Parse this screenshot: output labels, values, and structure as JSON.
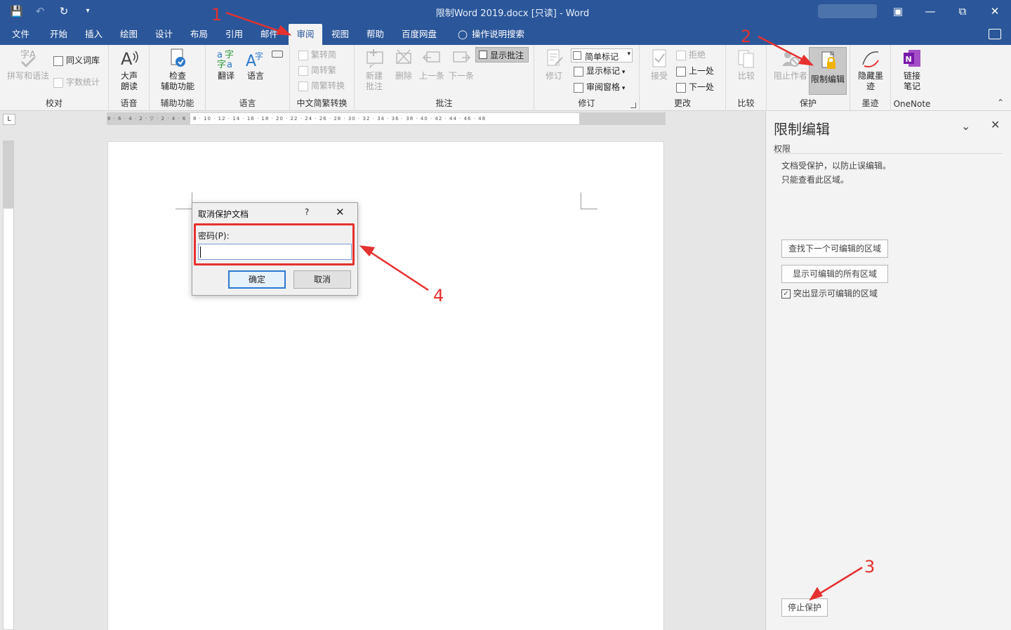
{
  "titlebar": {
    "title": "限制Word 2019.docx [只读]  -  Word",
    "controls": [
      "ribbon-display-icon",
      "minimize-icon",
      "restore-icon",
      "close-icon"
    ]
  },
  "tabs": [
    {
      "label": "文件"
    },
    {
      "label": "开始"
    },
    {
      "label": "插入"
    },
    {
      "label": "绘图"
    },
    {
      "label": "设计"
    },
    {
      "label": "布局"
    },
    {
      "label": "引用"
    },
    {
      "label": "邮件"
    },
    {
      "label": "审阅",
      "active": true
    },
    {
      "label": "视图"
    },
    {
      "label": "帮助"
    },
    {
      "label": "百度网盘"
    },
    {
      "label": "操作说明搜索"
    }
  ],
  "ribbon": {
    "proofing": {
      "label": "校对",
      "spelling": "拼写和语法",
      "thesaurus": "同义词库",
      "wordcount": "字数统计"
    },
    "speech": {
      "label": "语音",
      "read_aloud_1": "大声",
      "read_aloud_2": "朗读"
    },
    "accessibility": {
      "label": "辅助功能",
      "check_1": "检查",
      "check_2": "辅助功能"
    },
    "language": {
      "label": "语言",
      "translate": "翻译",
      "lang": "语言"
    },
    "chinese": {
      "label": "中文简繁转换",
      "to_simplified": "繁转简",
      "to_traditional": "简转繁",
      "convert": "简繁转换"
    },
    "comments": {
      "label": "批注",
      "new_1": "新建",
      "new_2": "批注",
      "delete": "删除",
      "prev": "上一条",
      "next": "下一条",
      "show": "显示批注"
    },
    "tracking": {
      "label": "修订",
      "track": "修订",
      "markup": "简单标记",
      "show_markup": "显示标记",
      "pane": "审阅窗格"
    },
    "changes": {
      "label": "更改",
      "accept": "接受",
      "reject": "拒绝",
      "prev": "上一处",
      "next": "下一处"
    },
    "compare": {
      "label": "比较",
      "compare": "比较"
    },
    "protect": {
      "label": "保护",
      "block": "阻止作者",
      "restrict": "限制编辑"
    },
    "ink": {
      "label": "墨迹",
      "hide_1": "隐藏墨",
      "hide_2": "迹"
    },
    "onenote": {
      "label": "OneNote",
      "link_1": "链接",
      "link_2": "笔记"
    }
  },
  "ruler": {
    "h_ticks": "8 · 6 · 4 · 2 · ▽ · 2 · 4 · 6 · 8 · 10 · 12 · 14 · 16 · 18 · 20 · 22 · 24 · 26 · 28 · 30 · 32 · 34 · 36 · 38 · 40 · 42 · 44 · 46 · 48",
    "corner": "L"
  },
  "dialog": {
    "title": "取消保护文档",
    "help": "?",
    "password_label": "密码(P):",
    "password_value": "",
    "ok": "确定",
    "cancel": "取消"
  },
  "pane": {
    "title": "限制编辑",
    "section": "权限",
    "line1": "文档受保护，以防止误编辑。",
    "line2": "只能查看此区域。",
    "find_next": "查找下一个可编辑的区域",
    "show_all": "显示可编辑的所有区域",
    "highlight": "突出显示可编辑的区域",
    "highlight_checked": true,
    "stop": "停止保护"
  },
  "annotations": {
    "n1": "1",
    "n2": "2",
    "n3": "3",
    "n4": "4",
    "color": "#e5312f"
  },
  "colors": {
    "accent": "#2b579a",
    "ribbon": "#f3f3f3",
    "annotation": "#e5312f"
  }
}
